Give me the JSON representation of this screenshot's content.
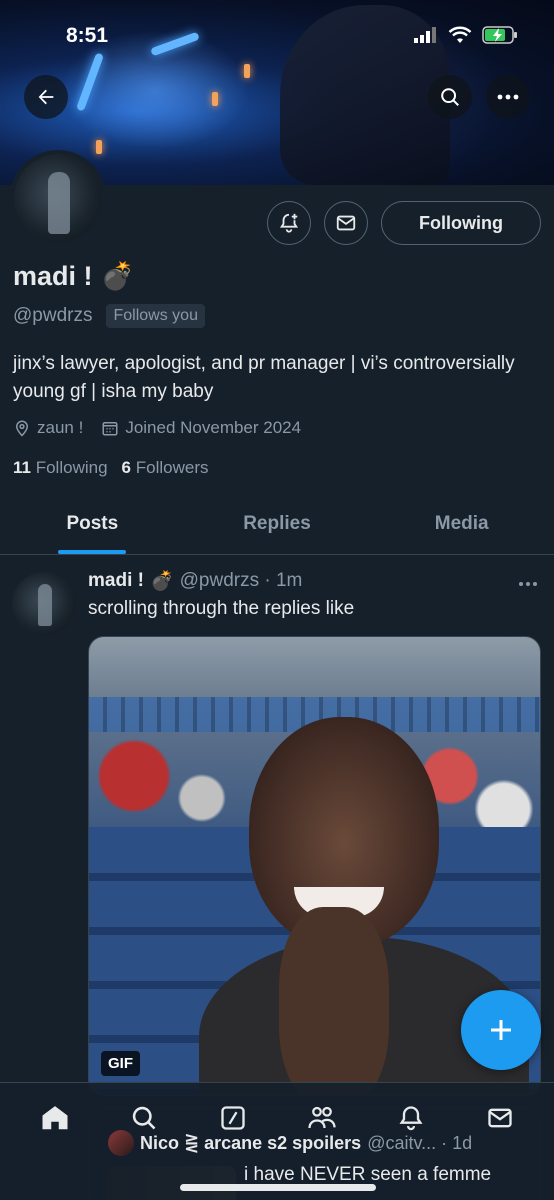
{
  "status_bar": {
    "time": "8:51"
  },
  "header": {
    "back_icon": "back-arrow-icon",
    "search_icon": "search-icon",
    "more_icon": "more-dots-icon"
  },
  "profile": {
    "display_name": "madi !",
    "name_emoji": "💣",
    "handle": "@pwdrzs",
    "follows_you": "Follows you",
    "bio": "jinx’s lawyer, apologist, and pr manager | vi’s controversially young gf | isha my baby",
    "location": "zaun !",
    "joined": "Joined November 2024",
    "following_count": "11",
    "following_label": "Following",
    "followers_count": "6",
    "followers_label": "Followers",
    "follow_button": "Following"
  },
  "tabs": [
    {
      "label": "Posts",
      "active": true
    },
    {
      "label": "Replies",
      "active": false
    },
    {
      "label": "Media",
      "active": false
    }
  ],
  "post": {
    "name": "madi !",
    "name_emoji": "💣",
    "handle_time": "@pwdrzs · 1m",
    "text": "scrolling through the replies like",
    "media_badge": "GIF"
  },
  "peek_post": {
    "name": "Nico ⋛ arcane s2 spoilers",
    "handle_time": "@caitv... · 1d",
    "text": "i have NEVER seen a femme"
  },
  "bottom_nav": [
    "home-icon",
    "search-icon",
    "compose-grok-icon",
    "communities-icon",
    "notifications-icon",
    "messages-icon"
  ],
  "colors": {
    "background": "#15202b",
    "accent": "#1d9bf0",
    "muted": "#8b98a5",
    "text": "#e7e9ea"
  }
}
